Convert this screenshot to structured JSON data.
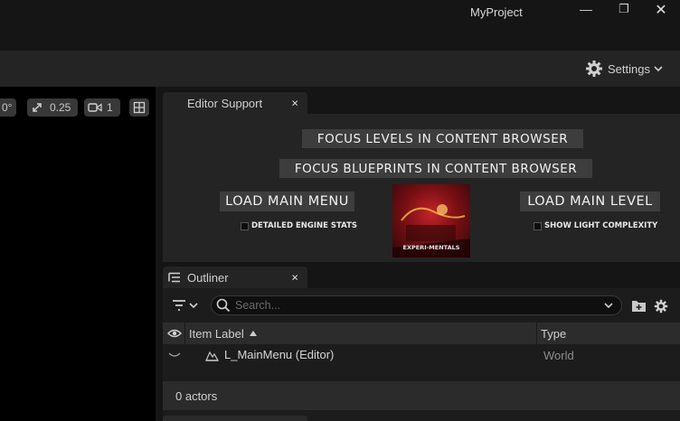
{
  "window": {
    "title": "MyProject",
    "minimize_glyph": "—",
    "restore_glyph": "❐",
    "close_glyph": "✕"
  },
  "toolbar": {
    "settings_label": "Settings"
  },
  "viewport_bar": {
    "rotation_value": "0°",
    "scale_value": "0.25",
    "camera_speed_value": "1"
  },
  "editor_support": {
    "tab_label": "Editor Support",
    "close_glyph": "×",
    "focus_levels_label": "Focus Levels in Content Browser",
    "focus_blueprints_label": "Focus Blueprints in Content Browser",
    "load_main_menu_label": "Load Main Menu",
    "load_main_level_label": "Load Main Level",
    "detailed_engine_stats_label": "Detailed Engine Stats",
    "show_light_complexity_label": "Show Light Complexity",
    "thumbnail_text": "EXPERI-MENTALS"
  },
  "outliner": {
    "tab_label": "Outliner",
    "close_glyph": "×",
    "search_placeholder": "Search...",
    "columns": {
      "label": "Item Label",
      "type": "Type"
    },
    "rows": [
      {
        "label": "L_MainMenu (Editor)",
        "type": "World"
      }
    ],
    "status": "0 actors"
  },
  "icons": {
    "settings": "gear-icon",
    "search": "search-icon",
    "filter": "filter-icon",
    "visibility": "eye-icon",
    "world": "world-icon"
  }
}
